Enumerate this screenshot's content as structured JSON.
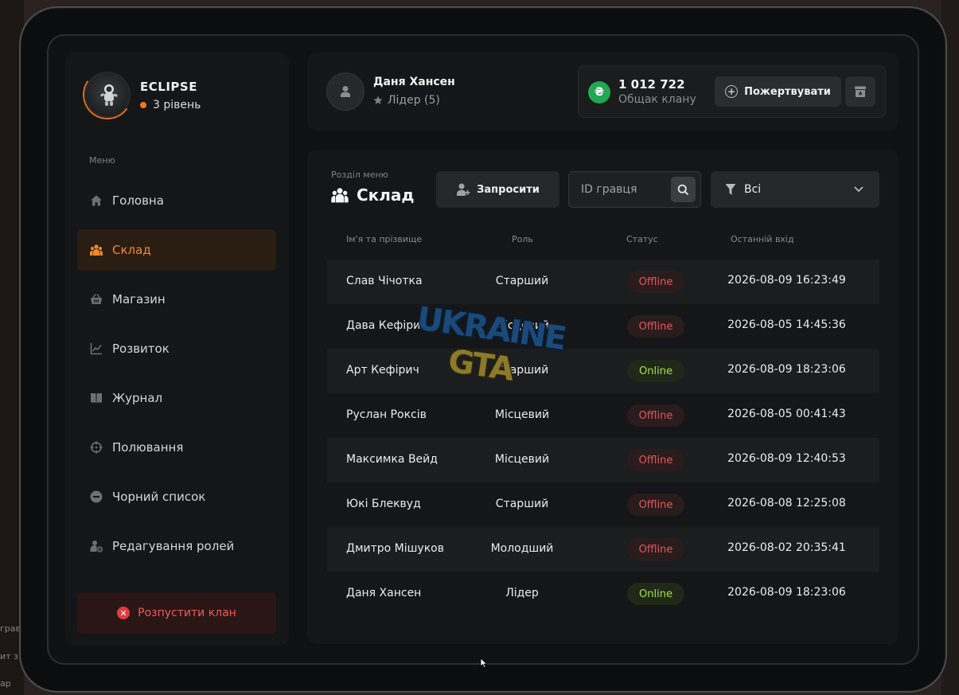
{
  "clan": {
    "name": "ECLIPSE",
    "level": "3 рівень"
  },
  "sidebar": {
    "caption": "Меню",
    "items": [
      {
        "label": "Головна",
        "icon": "home-icon"
      },
      {
        "label": "Склад",
        "icon": "users-icon"
      },
      {
        "label": "Магазин",
        "icon": "basket-icon"
      },
      {
        "label": "Розвиток",
        "icon": "chart-icon"
      },
      {
        "label": "Журнал",
        "icon": "book-icon"
      },
      {
        "label": "Полювання",
        "icon": "crosshair-icon"
      },
      {
        "label": "Чорний список",
        "icon": "minus-circle-icon"
      },
      {
        "label": "Редагування ролей",
        "icon": "user-gear-icon"
      }
    ],
    "active_index": 1,
    "disband_label": "Розпустити клан"
  },
  "header": {
    "user_name": "Даня Хансен",
    "user_role": "Лідер (5)",
    "bank_amount": "1 012 722",
    "bank_label": "Общак клану",
    "currency_symbol": "₴",
    "donate_label": "Пожертвувати"
  },
  "main": {
    "section_caption": "Розділ меню",
    "section_title": "Склад",
    "invite_label": "Запросити",
    "search_placeholder": "ID гравця",
    "filter_value": "Всі",
    "columns": [
      "Ім'я та прізвище",
      "Роль",
      "Статус",
      "Останній вхід"
    ],
    "members": [
      {
        "name": "Слав Чічотка",
        "role": "Старший",
        "status": "Offline",
        "last": "2026-08-09 16:23:49"
      },
      {
        "name": "Дава Кефірич",
        "role": "Місцевий",
        "status": "Offline",
        "last": "2026-08-05 14:45:36"
      },
      {
        "name": "Арт Кефірич",
        "role": "Старший",
        "status": "Online",
        "last": "2026-08-09 18:23:06"
      },
      {
        "name": "Руслан Роксів",
        "role": "Місцевий",
        "status": "Offline",
        "last": "2026-08-05 00:41:43"
      },
      {
        "name": "Максимка Вейд",
        "role": "Місцевий",
        "status": "Offline",
        "last": "2026-08-09 12:40:53"
      },
      {
        "name": "Юкі Блеквуд",
        "role": "Старший",
        "status": "Offline",
        "last": "2026-08-08 12:25:08"
      },
      {
        "name": "Дмитро Мішуков",
        "role": "Молодший",
        "status": "Offline",
        "last": "2026-08-02 20:35:41"
      },
      {
        "name": "Даня Хансен",
        "role": "Лідер",
        "status": "Online",
        "last": "2026-08-09 18:23:06"
      }
    ]
  },
  "watermark": {
    "line1": "UKRAINE",
    "line2": "GTA"
  },
  "background_text": [
    "грав",
    "ит з",
    "ар"
  ],
  "colors": {
    "accent": "#ef7a1a",
    "offline": "#e5565a",
    "online": "#a8e04a",
    "coin": "#22a850",
    "danger": "#e33b3b"
  }
}
